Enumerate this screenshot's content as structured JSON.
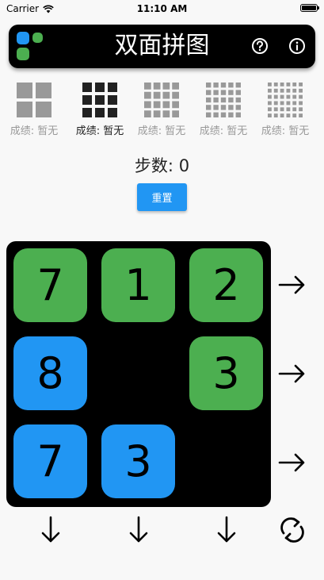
{
  "status_bar": {
    "carrier": "Carrier",
    "time": "11:10 AM"
  },
  "header": {
    "title": "双面拼图",
    "logo_colors": [
      "#2196f3",
      "#4caf50",
      "#4caf50"
    ]
  },
  "levels": [
    {
      "grid": 2,
      "score_label": "成绩: 暂无",
      "selected": false
    },
    {
      "grid": 3,
      "score_label": "成绩: 暂无",
      "selected": true
    },
    {
      "grid": 4,
      "score_label": "成绩: 暂无",
      "selected": false
    },
    {
      "grid": 5,
      "score_label": "成绩: 暂无",
      "selected": false
    },
    {
      "grid": 6,
      "score_label": "成绩: 暂无",
      "selected": false
    }
  ],
  "steps": {
    "label": "步数:",
    "count": "0"
  },
  "reset_label": "重置",
  "board": {
    "tiles": [
      {
        "row": 0,
        "col": 0,
        "value": "7",
        "color": "green"
      },
      {
        "row": 0,
        "col": 1,
        "value": "1",
        "color": "green"
      },
      {
        "row": 0,
        "col": 2,
        "value": "2",
        "color": "green"
      },
      {
        "row": 1,
        "col": 0,
        "value": "8",
        "color": "blue"
      },
      {
        "row": 1,
        "col": 2,
        "value": "3",
        "color": "green"
      },
      {
        "row": 2,
        "col": 0,
        "value": "7",
        "color": "blue"
      },
      {
        "row": 2,
        "col": 1,
        "value": "3",
        "color": "blue"
      }
    ]
  },
  "colors": {
    "green": "#4caf50",
    "blue": "#2196f3",
    "selected_icon": "#222222",
    "unselected_icon": "#999999"
  }
}
